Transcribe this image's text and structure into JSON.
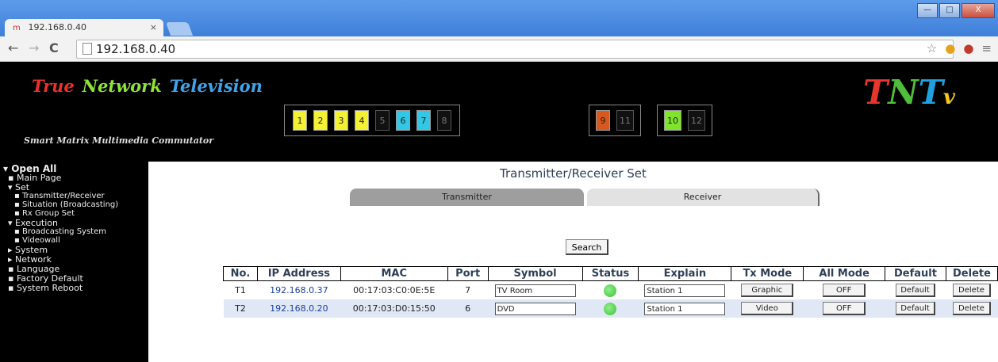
{
  "browser": {
    "tab_title": "192.168.0.40",
    "tab_close": "×",
    "url": "192.168.0.40",
    "win_minimize": "—",
    "win_maximize": "□",
    "win_close": "X"
  },
  "header": {
    "logo_words": [
      "True",
      "Network",
      "Television"
    ],
    "logo_colors": [
      "#e8322b",
      "#8fe237",
      "#3fa3e8"
    ],
    "tagline": "Smart Matrix Multimedia Commutator",
    "tntv_letters": [
      "T",
      "N",
      "T",
      "v"
    ],
    "tntv_colors": [
      "#e6362d",
      "#4fbf3b",
      "#1fa1e1",
      "#f2c81f"
    ],
    "ports_group1": [
      {
        "label": "1",
        "color": "#f4f033"
      },
      {
        "label": "2",
        "color": "#f4f033"
      },
      {
        "label": "3",
        "color": "#f4f033"
      },
      {
        "label": "4",
        "color": "#f4f033"
      },
      {
        "label": "5",
        "color": "#111111"
      },
      {
        "label": "6",
        "color": "#33c7e6"
      },
      {
        "label": "7",
        "color": "#33c7e6"
      },
      {
        "label": "8",
        "color": "#111111"
      }
    ],
    "ports_group2": [
      {
        "label": "9",
        "color": "#d9581f"
      },
      {
        "label": "11",
        "color": "#111111"
      }
    ],
    "ports_group3": [
      {
        "label": "10",
        "color": "#7fe52a"
      },
      {
        "label": "12",
        "color": "#111111"
      }
    ]
  },
  "sidebar": {
    "items": [
      {
        "label": "▾ Open All",
        "bold": true
      },
      {
        "label": "▪ Main Page"
      },
      {
        "label": "▾ Set"
      },
      {
        "label": "▪ Transmitter/Receiver"
      },
      {
        "label": "▪ Situation (Broadcasting)"
      },
      {
        "label": "▪ Rx Group Set"
      },
      {
        "label": "▾ Execution"
      },
      {
        "label": "▪ Broadcasting System"
      },
      {
        "label": "▪ Videowall"
      },
      {
        "label": "▸ System"
      },
      {
        "label": "▸ Network"
      },
      {
        "label": "▪ Language"
      },
      {
        "label": "▪ Factory Default"
      },
      {
        "label": "▪ System Reboot"
      }
    ]
  },
  "main": {
    "title": "Transmitter/Receiver Set",
    "tab_transmitter": "Transmitter",
    "tab_receiver": "Receiver",
    "search_label": "Search",
    "columns": [
      "No.",
      "IP Address",
      "MAC",
      "Port",
      "Symbol",
      "Status",
      "Explain",
      "Tx Mode",
      "All Mode",
      "Default",
      "Delete"
    ],
    "rows": [
      {
        "no": "T1",
        "ip": "192.168.0.37",
        "mac": "00:17:03:C0:0E:5E",
        "port": "7",
        "symbol": "TV Room",
        "status_color": "#3fbf3a",
        "explain": "Station 1",
        "tx_mode": "Graphic",
        "all_mode": "OFF",
        "default": "Default",
        "delete": "Delete"
      },
      {
        "no": "T2",
        "ip": "192.168.0.20",
        "mac": "00:17:03:D0:15:50",
        "port": "6",
        "symbol": "DVD",
        "status_color": "#3fbf3a",
        "explain": "Station 1",
        "tx_mode": "Video",
        "all_mode": "OFF",
        "default": "Default",
        "delete": "Delete"
      }
    ]
  }
}
